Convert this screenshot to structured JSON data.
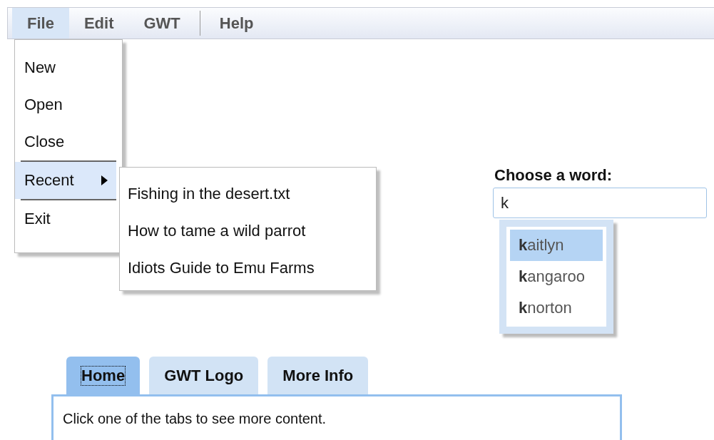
{
  "menubar": {
    "items": [
      {
        "label": "File",
        "selected": true
      },
      {
        "label": "Edit",
        "selected": false
      },
      {
        "label": "GWT",
        "selected": false
      },
      {
        "kind": "separator"
      },
      {
        "label": "Help",
        "selected": false
      }
    ]
  },
  "file_menu": {
    "items": [
      {
        "kind": "item",
        "label": "New",
        "selected": false
      },
      {
        "kind": "item",
        "label": "Open",
        "selected": false
      },
      {
        "kind": "item",
        "label": "Close",
        "selected": false
      },
      {
        "kind": "separator"
      },
      {
        "kind": "submenu",
        "label": "Recent",
        "selected": true
      },
      {
        "kind": "separator"
      },
      {
        "kind": "item",
        "label": "Exit",
        "selected": false
      }
    ]
  },
  "recent_menu": {
    "items": [
      "Fishing in the desert.txt",
      "How to tame a wild parrot",
      "Idiots Guide to Emu Farms"
    ]
  },
  "word_box": {
    "label": "Choose a word:",
    "value": "k",
    "suggestions": [
      {
        "text": "**k**aitlyn",
        "selected": true
      },
      {
        "text": "**k**angaroo",
        "selected": false
      },
      {
        "text": "**k**norton",
        "selected": false
      }
    ]
  },
  "tabs": [
    {
      "label": "Home",
      "selected": true
    },
    {
      "label": "GWT Logo",
      "selected": false
    },
    {
      "label": "More Info",
      "selected": false
    }
  ],
  "tab_content": "Click one of the tabs to see more content."
}
